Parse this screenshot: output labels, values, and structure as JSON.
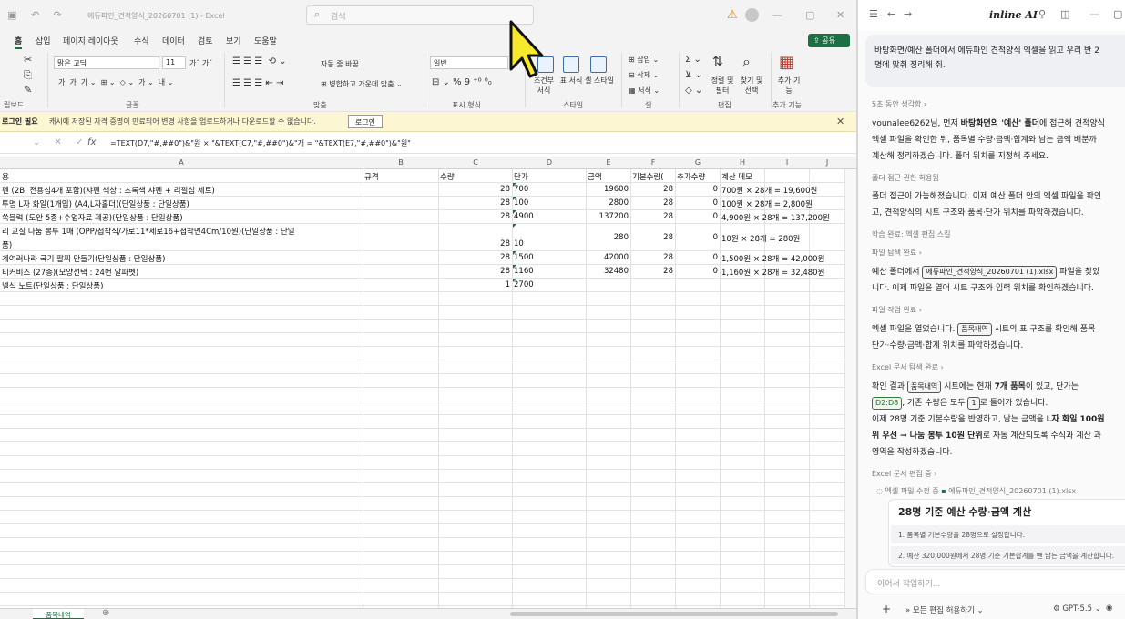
{
  "excel": {
    "title": "에듀파인_견적양식_20260701 (1) - Excel",
    "search_placeholder": "검색",
    "share_label": "공유",
    "menu": [
      "홈",
      "삽입",
      "페이지 레이아웃",
      "수식",
      "데이터",
      "검토",
      "보기",
      "도움말"
    ],
    "ribbon": {
      "font_name": "맑은 고딕",
      "font_size": "11",
      "number_format": "일반",
      "wrap_text": "자동 줄 바꿈",
      "merge_center": "병합하고 가운데 맞춤",
      "cond_format": "조건부 서식",
      "table_format": "표 서식",
      "cell_style": "셀 스타일",
      "insert": "삽입",
      "delete": "삭제",
      "format": "서식",
      "sort_filter": "정렬 및 필터",
      "find_select": "찾기 및 선택",
      "addins": "추가 기능",
      "groups": [
        "립보드",
        "글꼴",
        "맞춤",
        "표시 형식",
        "스타일",
        "셀",
        "편집",
        "추가 기능"
      ]
    },
    "message_bar": {
      "title": "로그인 필요",
      "text": "캐시에 저장된 자격 증명이 만료되어 변경 사항을 업로드하거나 다운로드할 수 없습니다.",
      "button": "로그인"
    },
    "formula": "=TEXT(D7,\"#,##0\")&\"원 × \"&TEXT(C7,\"#,##0\")&\"개 = \"&TEXT(E7,\"#,##0\")&\"원\"",
    "columns": [
      "A",
      "B",
      "C",
      "D",
      "E",
      "F",
      "G",
      "H",
      "I",
      "J"
    ],
    "header_row": {
      "a": "용",
      "b": "규격",
      "c": "수량",
      "d": "단가",
      "e": "금액",
      "f": "기본수량(",
      "g": "추가수량",
      "h": "계산 메모"
    },
    "rows": [
      {
        "a": "펜 (2B, 전용심4개 포함)(샤펜 색상 : 초록색 샤펜 + 리필심 세트)",
        "c": "28",
        "d": "700",
        "e": "19600",
        "f": "28",
        "g": "0",
        "h": "700원 × 28개 = 19,600원"
      },
      {
        "a": "투명 L자 화일(1개입) (A4,L자홀더)(단일상품 : 단일상품)",
        "c": "28",
        "d": "100",
        "e": "2800",
        "f": "28",
        "g": "0",
        "h": "100원 × 28개 = 2,800원"
      },
      {
        "a": "쏙블럭 (도안 5종+수업자료 제공)(단일상품 : 단일상품)",
        "c": "28",
        "d": "4900",
        "e": "137200",
        "f": "28",
        "g": "0",
        "h": "4,900원 × 28개 = 137,200원"
      },
      {
        "a": "리 교실 나눔 봉투 1매 (OPP/접착식/가로11*세로16+접착면4Cm/10원)(단일상품 : 단일",
        "a2": "품)",
        "c": "28",
        "d": "10",
        "e": "280",
        "f": "28",
        "g": "0",
        "h": "10원 × 28개 = 280원"
      },
      {
        "a": "계여러나라 국기 팔찌 만들기(단일상품 : 단일상품)",
        "c": "28",
        "d": "1500",
        "e": "42000",
        "f": "28",
        "g": "0",
        "h": "1,500원 × 28개 = 42,000원"
      },
      {
        "a": "티커비즈 (27종)(모양선택 : 24번 알파벳)",
        "c": "28",
        "d": "1160",
        "e": "32480",
        "f": "28",
        "g": "0",
        "h": "1,160원 × 28개 = 32,480원"
      },
      {
        "a": "넬식 노트(단일상품 : 단일상품)",
        "c": "1",
        "d": "2700"
      }
    ],
    "sheet_tab": "품목내역"
  },
  "ai": {
    "brand": "inline AI",
    "user_message_1": "바탕화면/예산 폴더에서 에듀파인 견적양식 엑셀을 읽고 우리 반 2",
    "user_message_2": "명에 맞춰 정리해 줘.",
    "thought": "5초 동안 생각함 ›",
    "p1_1_pre": "younalee6262님, 먼저 ",
    "p1_1_bold": "바탕화면의 '예산' 폴더",
    "p1_1_post": "에 접근해 견적양식",
    "p1_2": "엑셀 파일을 확인한 뒤, 품목별 수량·금액·합계와 남는 금액 배분까",
    "p1_3": "계산해 정리하겠습니다. 폴더 위치를 지정해 주세요.",
    "s1": "폴더 접근 권한 허용됨",
    "p2_1": "폴더 접근이 가능해졌습니다. 이제 예산 폴더 안의 엑셀 파일을 확인",
    "p2_2": "고, 견적양식의 시트 구조와 품목·단가 위치를 파악하겠습니다.",
    "s2": "학습 완료: 엑셀 편집 스킬",
    "s3": "파일 탐색 완료 ›",
    "p3_1_pre": "예산 폴더에서 ",
    "p3_1_chip": "에듀파인_견적양식_20260701 (1).xlsx",
    "p3_1_post": " 파일을 찾았",
    "p3_2": "니다. 이제 파일을 열어 시트 구조와 입력 위치를 확인하겠습니다.",
    "s4": "파일 작업 완료 ›",
    "p4_1_pre": "엑셀 파일을 열었습니다. ",
    "p4_1_chip": "품목내역",
    "p4_1_post": " 시트의 표 구조를 확인해 품목",
    "p4_2": "단가·수량·금액·합계 위치를 파악하겠습니다.",
    "s5": "Excel 문서 탐색 완료 ›",
    "p5_1_pre": "확인 결과 ",
    "p5_1_chip": "품목내역",
    "p5_1_mid": " 시트에는 현재 ",
    "p5_1_bold": "7개 품목",
    "p5_1_post": "이 있고, 단가는",
    "p5_2_chip": "D2:D8",
    "p5_2_mid": ", 기존 수량은 모두 ",
    "p5_2_chip2": "1",
    "p5_2_post": "로 들어가 있습니다.",
    "p5_3_pre": "이제 28명 기준 기본수량을 반영하고, 남는 금액을 ",
    "p5_3_bold": "L자 화일 100원",
    "p5_4_bold": "위 우선 → 나눔 봉투 10원 단위",
    "p5_4_post": "로 자동 계산되도록 수식과 계산 과",
    "p5_5": "영역을 작성하겠습니다.",
    "s6": "Excel 문서 편집 중 ›",
    "s7_pre": "엑셀 파일 수정 중 ",
    "s7_file": "에듀파인_견적양식_20260701 (1).xlsx",
    "card_title": "28명 기준 예산 수량·금액 계산",
    "card_l1": "1. 품목별 기본수량을 28명으로 설정합니다.",
    "card_l2": "2. 예산 320,000원에서 28명 기준 기본합계를 뺀 남는 금액을 계산합니다.",
    "input_placeholder": "이어서 작업하기...",
    "allow_edits": "» 모든 편집 허용하기 ⌄",
    "model": "GPT-5.5 ⌄"
  }
}
